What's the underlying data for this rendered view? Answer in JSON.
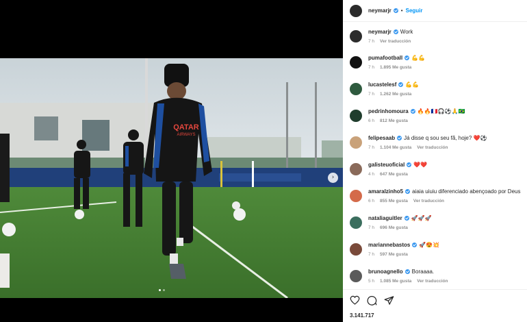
{
  "post": {
    "author": "neymarjr",
    "follow_label": "Seguir",
    "separator": "•",
    "likes": "3.141.717",
    "carousel_next": "›"
  },
  "comments": [
    {
      "user": "neymarjr",
      "text": "Work",
      "time": "7 h",
      "likes": "",
      "reply": "Ver traducción",
      "avatar": "#2c2c2c"
    },
    {
      "user": "pumafootball",
      "text": "💪💪",
      "time": "7 h",
      "likes": "1.895 Me gusta",
      "reply": "",
      "avatar": "#111111"
    },
    {
      "user": "lucastelesf",
      "text": "💪💪",
      "time": "7 h",
      "likes": "1.262 Me gusta",
      "reply": "",
      "avatar": "#2e5a3e"
    },
    {
      "user": "pedrinhomoura",
      "text": "🔥🔥🇫🇷🎧⚽🙏🇧🇷",
      "time": "6 h",
      "likes": "812 Me gusta",
      "reply": "",
      "avatar": "#1f3d2d"
    },
    {
      "user": "felipesaab",
      "text": "Já disse q sou seu fã, hoje? ❤️⚽",
      "time": "7 h",
      "likes": "1.104 Me gusta",
      "reply": "Ver traducción",
      "avatar": "#c9a27a"
    },
    {
      "user": "galisteuoficial",
      "text": "❤️❤️",
      "time": "4 h",
      "likes": "647 Me gusta",
      "reply": "",
      "avatar": "#8a6a5a"
    },
    {
      "user": "amaralzinho5",
      "text": "aiaia uiuiu diferenciado abençoado por Deus",
      "time": "6 h",
      "likes": "855 Me gusta",
      "reply": "Ver traducción",
      "avatar": "#d46a4a"
    },
    {
      "user": "nataliaguitler",
      "text": "🚀🚀🚀",
      "time": "7 h",
      "likes": "696 Me gusta",
      "reply": "",
      "avatar": "#3b6e5e"
    },
    {
      "user": "mariannebastos",
      "text": "🚀😍💥",
      "time": "7 h",
      "likes": "597 Me gusta",
      "reply": "",
      "avatar": "#7a4a3a"
    },
    {
      "user": "brunoagnello",
      "text": "Boraaaa.",
      "time": "5 h",
      "likes": "1.085 Me gusta",
      "reply": "Ver traducción",
      "avatar": "#5a5a5a"
    }
  ],
  "photo": {
    "shirt_text_1": "QATAR",
    "shirt_text_2": "AIRWAYS"
  },
  "colors": {
    "verified": "#3897f0",
    "follow": "#0095f6",
    "psg_blue": "#1e4fa0"
  },
  "icons": [
    "heart-icon",
    "comment-icon",
    "share-icon",
    "verified-badge-icon",
    "chevron-right-icon"
  ]
}
